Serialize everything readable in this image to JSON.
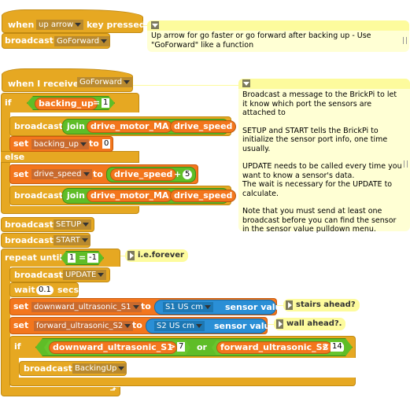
{
  "script1": {
    "hat": {
      "when": "when",
      "key": "up arrow",
      "pressed": "key pressed"
    },
    "broadcast": {
      "label": "broadcast",
      "message": "GoForward"
    }
  },
  "note1": {
    "text": "Up arrow for go faster or go forward after backing up - Use \"GoForward\" like a function"
  },
  "script2": {
    "hat": {
      "label": "when I receive",
      "message": "GoForward"
    },
    "if1": {
      "label": "if",
      "cond": {
        "var": "backing_up",
        "op": "=",
        "value": "1"
      },
      "then": {
        "broadcast": {
          "label": "broadcast",
          "join": "join",
          "a": "drive_motor_MA",
          "b": "drive_speed"
        },
        "set": {
          "label": "set",
          "var": "backing_up",
          "to": "to",
          "value": "0"
        }
      },
      "else_label": "else",
      "else": {
        "set": {
          "label": "set",
          "var": "drive_speed",
          "to": "to",
          "expr_var": "drive_speed",
          "op": "+",
          "value": "5"
        },
        "broadcast": {
          "label": "broadcast",
          "join": "join",
          "a": "drive_motor_MA",
          "b": "drive_speed"
        }
      }
    },
    "broadcast_setup": {
      "label": "broadcast",
      "message": "SETUP"
    },
    "broadcast_start": {
      "label": "broadcast",
      "message": "START"
    },
    "repeat": {
      "label": "repeat until",
      "cond": {
        "left": "1",
        "op": "=",
        "right": "-1"
      },
      "note": "i.e.forever",
      "broadcast_update": {
        "label": "broadcast",
        "message": "UPDATE"
      },
      "wait": {
        "label": "wait",
        "value": "0.1",
        "unit": "secs"
      },
      "set_s1": {
        "label": "set",
        "var": "downward_ultrasonic_S1",
        "to": "to",
        "sensor": "S1 US cm",
        "sensor_label": "sensor value",
        "note": "stairs ahead?"
      },
      "set_s2": {
        "label": "set",
        "var": "forward_ultrasonic_S2",
        "to": "to",
        "sensor": "S2 US cm",
        "sensor_label": "sensor value",
        "note": "wall ahead?."
      },
      "if2": {
        "label": "if",
        "left": {
          "var": "downward_ultrasonic_S1",
          "op": ">",
          "value": "7"
        },
        "or": "or",
        "right": {
          "var": "forward_ultrasonic_S2",
          "op": "<",
          "value": "14"
        },
        "broadcast": {
          "label": "broadcast",
          "message": "BackingUp"
        }
      }
    }
  },
  "note2": {
    "paragraphs": [
      "Broadcast a message to the BrickPi to let it know which port the sensors are attached to",
      "SETUP and START tells the BrickPi to initialize the sensor port info, one time usually.",
      "UPDATE needs to be called every time you want to know a sensor's data.\nThe wait is necessary for the UPDATE to calculate.",
      "Note that you must send at least one broadcast before you can find the sensor in the sensor value pulldown menu."
    ]
  }
}
